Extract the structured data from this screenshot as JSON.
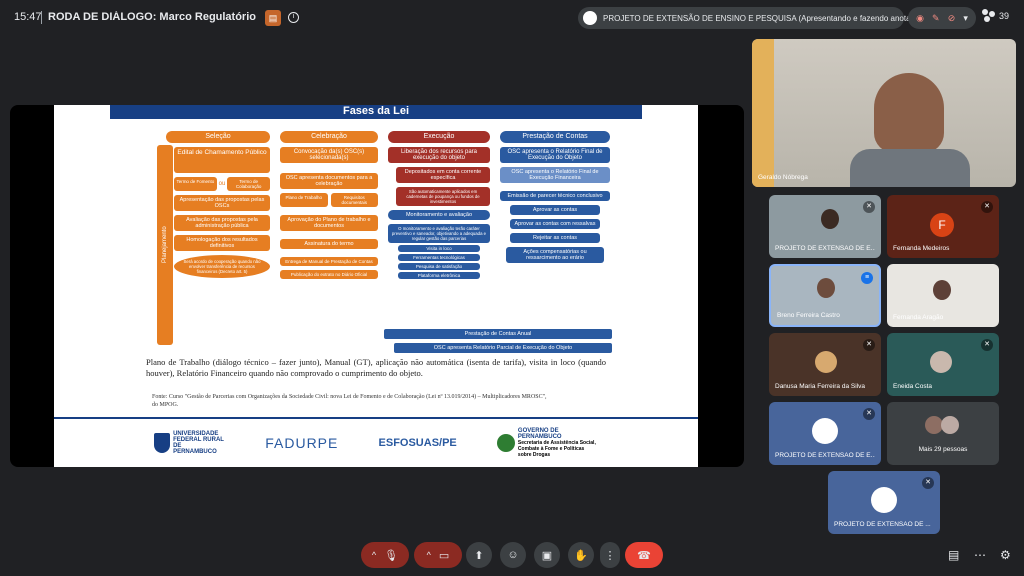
{
  "topbar": {
    "time": "15:47",
    "meeting_title": "RODA DE DIÁLOGO: Marco Regulatório da Socieda...",
    "presenter": "PROJETO DE EXTENSÃO DE ENSINO E PESQUISA (Apresentando e fazendo anotações)",
    "participant_count": "39"
  },
  "slide": {
    "title": "Fases da Lei",
    "planejamento": "Planejamento",
    "columns": [
      {
        "header": "Seleção",
        "items": [
          "Edital de Chamamento Público",
          "Termo de Fomento",
          "ou",
          "Termo de Colaboração",
          "Apresentação das propostas pelas OSCs",
          "Avaliação das propostas pela administração pública",
          "Homologação dos resultados definitivos",
          "Será acordo de cooperação quando não envolver transferência de recursos financeiros (Decreto art. 5)"
        ]
      },
      {
        "header": "Celebração",
        "items": [
          "Convocação da(s) OSC(s) selecionada(s)",
          "OSC apresenta documentos para a celebração",
          "Plano de Trabalho",
          "Requisitos documentais",
          "Aprovação do Plano de trabalho e documentos",
          "Assinatura do termo",
          "Entrega de Manual de Prestação de Contas",
          "Publicação do extrato no Diário Oficial"
        ]
      },
      {
        "header": "Execução",
        "items": [
          "Liberação dos recursos para execução do objeto",
          "Depositados em conta corrente específica",
          "São automaticamente aplicados em cadernetas de poupança ou fundos de investimentos",
          "Monitoramento e avaliação",
          "O monitoramento e avaliação terão caráter preventivo e saneador, objetivando a adequada e regular gestão das parcerias",
          "Visita in loco",
          "Ferramentas tecnológicas",
          "Pesquisa de satisfação",
          "Plataforma eletrônica"
        ]
      },
      {
        "header": "Prestação de Contas",
        "items": [
          "OSC apresenta o Relatório Final de Execução do Objeto",
          "OSC apresenta o Relatório Final de Execução Financeira",
          "Emissão de parecer técnico conclusivo",
          "Aprovar as contas",
          "Aprovar as contas com ressalvas",
          "Rejeitar as contas",
          "Ações compensatórias ou ressarcimento ao erário"
        ]
      }
    ],
    "annual": "Prestação de Contas Anual",
    "partial": "OSC apresenta Relatório Parcial de Execução do Objeto",
    "body_text": "Plano de Trabalho (diálogo técnico – fazer junto), Manual (GT), aplicação não automática (isenta de tarifa), visita in loco (quando houver), Relatório Financeiro quando não comprovado o cumprimento do objeto.",
    "source": "Fonte: Curso \"Gestão de Parcerias com Organizações da Sociedade Civil: nova Lei de Fomento e de Colaboração (Lei nº 13.019/2014) – Multiplicadores MROSC\", do MPOG.",
    "logos": {
      "ufrpe": "UNIVERSIDADE FEDERAL RURAL DE PERNAMBUCO",
      "fadurpe": "FADURPE",
      "esfosuas": "ESFOSUAS/PE",
      "gov": "GOVERNO DE PERNAMBUCO",
      "gov_sub": "Secretaria de Assistência Social, Combate à Fome e Políticas sobre Drogas"
    }
  },
  "participants": {
    "main": "Geraldo Nóbrega",
    "tiles": [
      {
        "name": "PROJETO DE EXTENSÃO DE E..."
      },
      {
        "name": "Fernanda Medeiros",
        "initial": "F"
      },
      {
        "name": "Breno Ferreira Castro"
      },
      {
        "name": "Fernanda Aragão"
      },
      {
        "name": "Danusa Maria Ferreira da Silva"
      },
      {
        "name": "Eneida Costa"
      },
      {
        "name": "PROJETO DE EXTENSÃO DE E..."
      },
      {
        "name": "Mais 29 pessoas"
      },
      {
        "name": "PROJETO DE EXTENSÃO DE ..."
      }
    ]
  },
  "controls": {
    "icons": [
      "chevron-up-icon",
      "mic-off-icon",
      "chevron-up-icon",
      "camera-off-icon",
      "present-icon",
      "emoji-icon",
      "captions-icon",
      "raise-hand-icon",
      "more-icon",
      "end-call-icon"
    ],
    "right_icons": [
      "chat-icon",
      "apps-icon",
      "host-controls-icon"
    ]
  },
  "colors": {
    "background": "#202124",
    "end_call": "#ea4335",
    "slide_blue": "#173f84",
    "slide_orange": "#e67e22"
  }
}
